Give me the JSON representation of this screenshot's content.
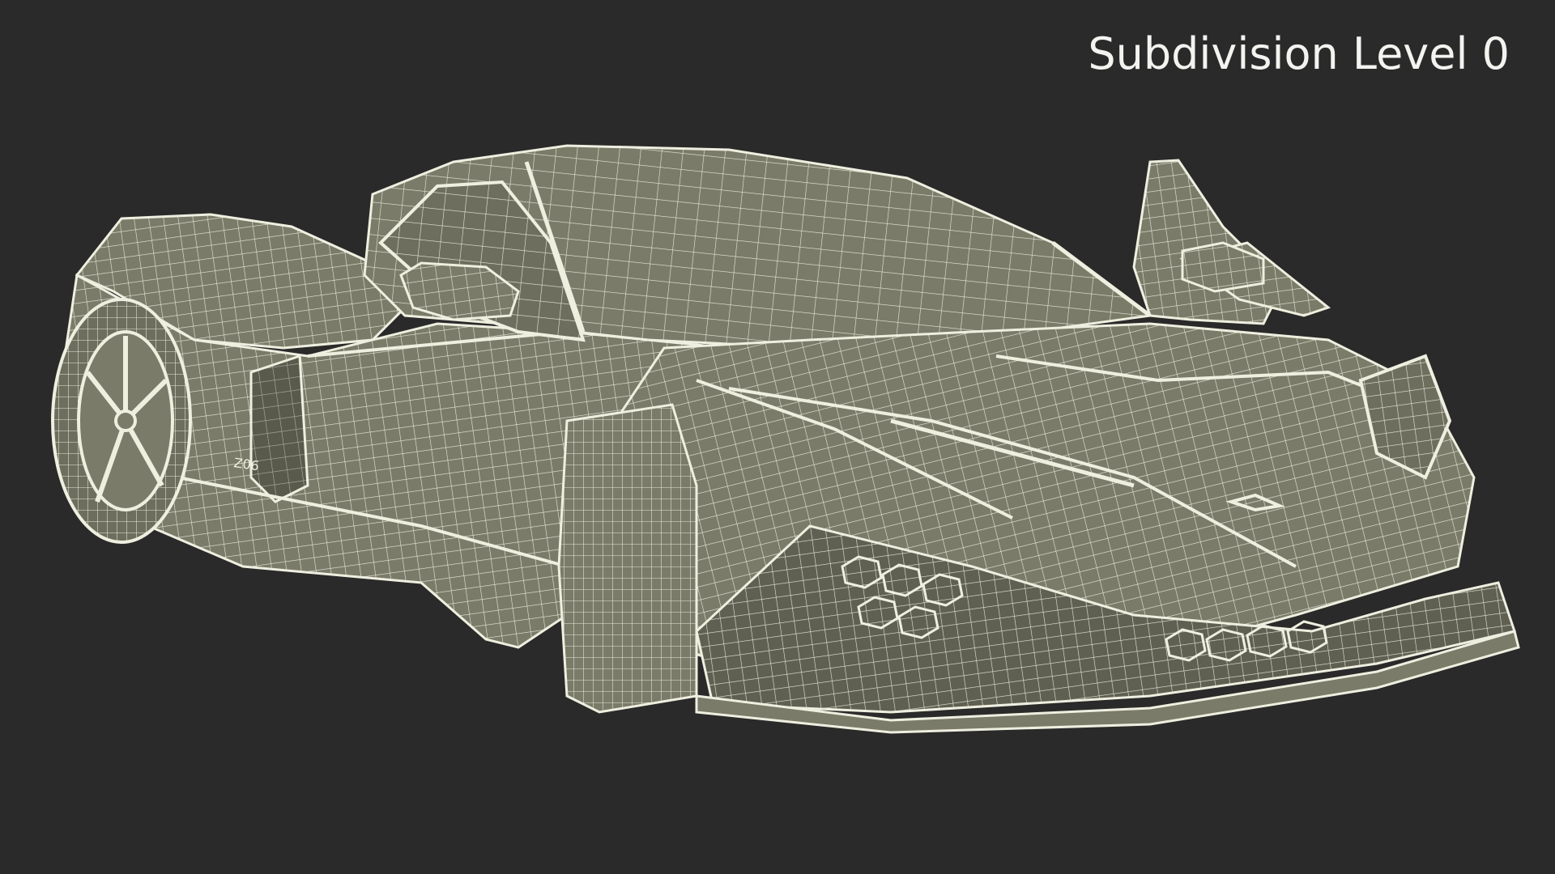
{
  "viewport": {
    "overlay_label": "Subdivision Level 0",
    "background_color": "#2a2a2a",
    "mesh_fill_color": "#7b7b6a",
    "mesh_line_color": "#efefe0"
  },
  "model": {
    "subject": "sports car wireframe render",
    "side_badge": "Z06"
  }
}
